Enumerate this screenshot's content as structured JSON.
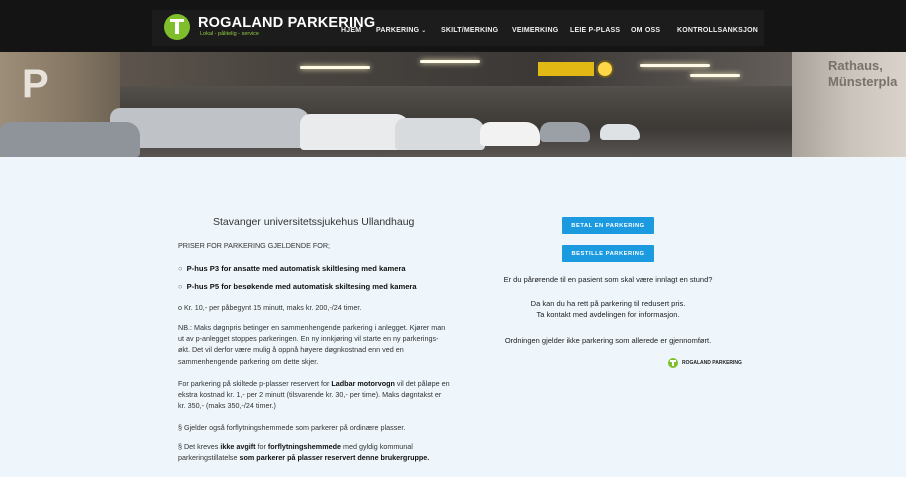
{
  "brand": {
    "name": "ROGALAND PARKERING",
    "tagline": "Lokal - pålitelig - service",
    "logo_icon": "rp-logo-icon",
    "accent": "#7fbf2b"
  },
  "nav": [
    {
      "label": "HJEM"
    },
    {
      "label": "PARKERING",
      "dropdown": true
    },
    {
      "label": "SKILT/MERKING"
    },
    {
      "label": "VEIMERKING"
    },
    {
      "label": "LEIE P-PLASS"
    },
    {
      "label": "OM OSS"
    },
    {
      "label": "KONTROLLSANKSJON"
    }
  ],
  "hero": {
    "letter": "P",
    "sign_text": "Münsterpla",
    "sign_text_line1": "Rathaus,"
  },
  "content": {
    "title": "Stavanger universitetssjukehus Ullandhaug",
    "intro": "PRISER FOR PARKERING GJELDENDE FOR;",
    "bullets": [
      "P-hus P3 for ansatte med automatisk skiltlesing med kamera",
      "P-hus P5 for besøkende med automatisk skiltesing med kamera"
    ],
    "price": "o  Kr. 10,- per påbegynt 15 minutt, maks kr. 200,-/24 timer.",
    "nb": "NB.: Maks døgnpris betinger en sammenhengende parkering i anlegget. Kjører man ut av p-anlegget stoppes parkeringen. En ny innkjøring vil starte en ny parkerings-økt. Det vil derfor være mulig å oppnå høyere døgnkostnad enn ved en sammenhengende parkering om dette skjer.",
    "ladbar_pre": "For parkering på skiltede p-plasser reservert for ",
    "ladbar_bold": "Ladbar motorvogn",
    "ladbar_post": " vil det påløpe en ekstra kostnad kr. 1,- per 2 minutt (tilsvarende kr. 30,- per time). Maks døgntakst er kr. 350,- (maks 350,-/24 timer.)",
    "para_handicap": "§ Gjelder også forflytningshemmede som parkerer på ordinære plasser.",
    "avgift_1": "§ Det kreves ",
    "avgift_b1": "ikke avgift",
    "avgift_2": " for ",
    "avgift_b2": "forflytningshemmede",
    "avgift_3": " med gyldig kommunal parkeringstillatelse ",
    "avgift_b3": "som parkerer på plasser reservert denne brukergruppe."
  },
  "right": {
    "btn_pay": "BETAL EN PARKERING",
    "btn_order": "BESTILLE PARKERING",
    "q": "Er du pårørende til en pasient som skal være innlagt en stund?",
    "a1": "Da kan du ha rett på parkering til redusert pris.",
    "a2": "Ta kontakt med avdelingen for informasjon.",
    "note": "Ordningen gjelder ikke parkering som allerede er gjennomført.",
    "mini_brand": "ROGALAND PARKERING",
    "button_color": "#1b9ae0"
  }
}
